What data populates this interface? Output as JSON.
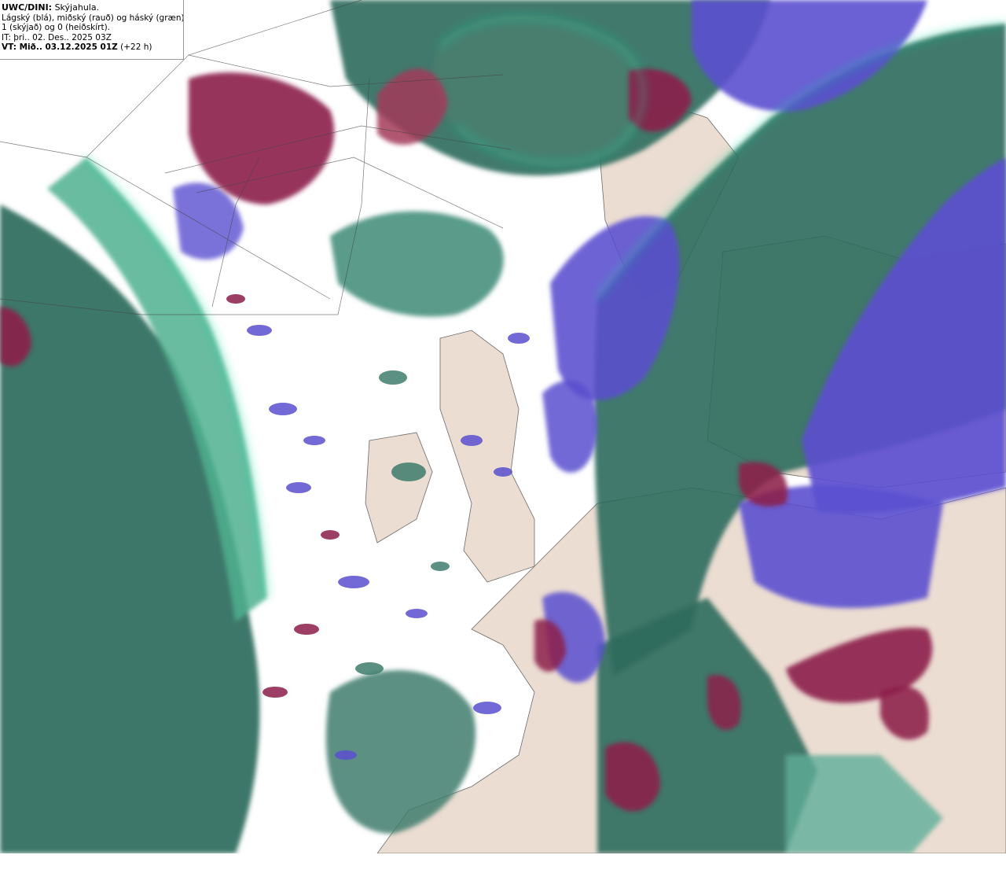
{
  "legend": {
    "model_label": "UWC/DINI:",
    "field_label": "Skýjahula.",
    "layers_line": "Lágský (blá), miðský (rauð) og háský (græn).",
    "scale_line": "1 (skýjað) og 0 (heiðskírt).",
    "init_time": "IT: þri.. 02. Des.. 2025 03Z",
    "valid_label": "VT: Mið.. 03.12.2025 01Z",
    "lead_time": "(+22 h)"
  },
  "colors": {
    "land": "#ecddd2",
    "ocean": "#ffffff",
    "low_cloud": "#5b4fcf",
    "mid_cloud": "#8c1d4a",
    "high_cloud": "#2e6b5c",
    "high_cloud_light": "#4fb08f",
    "cloud_edge": "#1fe0a8",
    "low_edge": "#3f6bff",
    "coast": "#6a6a6a"
  }
}
